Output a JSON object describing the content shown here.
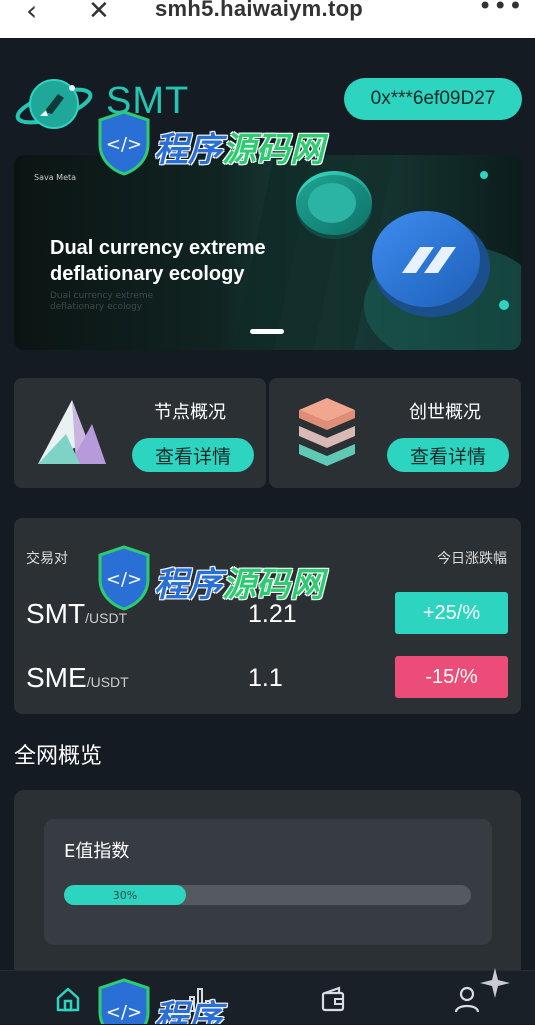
{
  "browser": {
    "back_glyph": "‹",
    "close_glyph": "✕",
    "url": "smh5.haiwaiym.top",
    "more_glyph": "•••"
  },
  "header": {
    "brand": "SMT",
    "wallet_address": "0x***6ef09D27"
  },
  "banner": {
    "brand_text": "Sava Meta",
    "title_line1": "Dual currency extreme",
    "title_line2": "deflationary ecology",
    "subtitle_line1": "Dual currency extreme",
    "subtitle_line2": "deflationary ecology"
  },
  "cards": [
    {
      "title": "节点概况",
      "button": "查看详情",
      "icon": "mountain-icon"
    },
    {
      "title": "创世概况",
      "button": "查看详情",
      "icon": "layers-icon"
    }
  ],
  "pairs": {
    "header_left": "交易对",
    "header_right": "今日涨跌幅",
    "rows": [
      {
        "symbol": "SMT",
        "quote": "/USDT",
        "price": "1.21",
        "change": "+25/%",
        "color": "#2dd4bf"
      },
      {
        "symbol": "SME",
        "quote": "/USDT",
        "price": "1.1",
        "change": "-15/%",
        "color": "#ec4d78"
      }
    ]
  },
  "overview": {
    "section_title": "全网概览",
    "e_label": "E值指数",
    "progress_text": "30%",
    "progress": 0.3
  },
  "tabbar": {
    "tabs": [
      "home-icon",
      "chart-icon",
      "wallet-icon",
      "user-icon"
    ],
    "active": "home-icon"
  },
  "watermark": {
    "part1": "程序",
    "part2": "源码网"
  },
  "colors": {
    "accent": "#2dd4bf",
    "brand": "#25c5b4",
    "negative": "#ec4d78",
    "background": "#141b23",
    "card": "#2b3034"
  }
}
